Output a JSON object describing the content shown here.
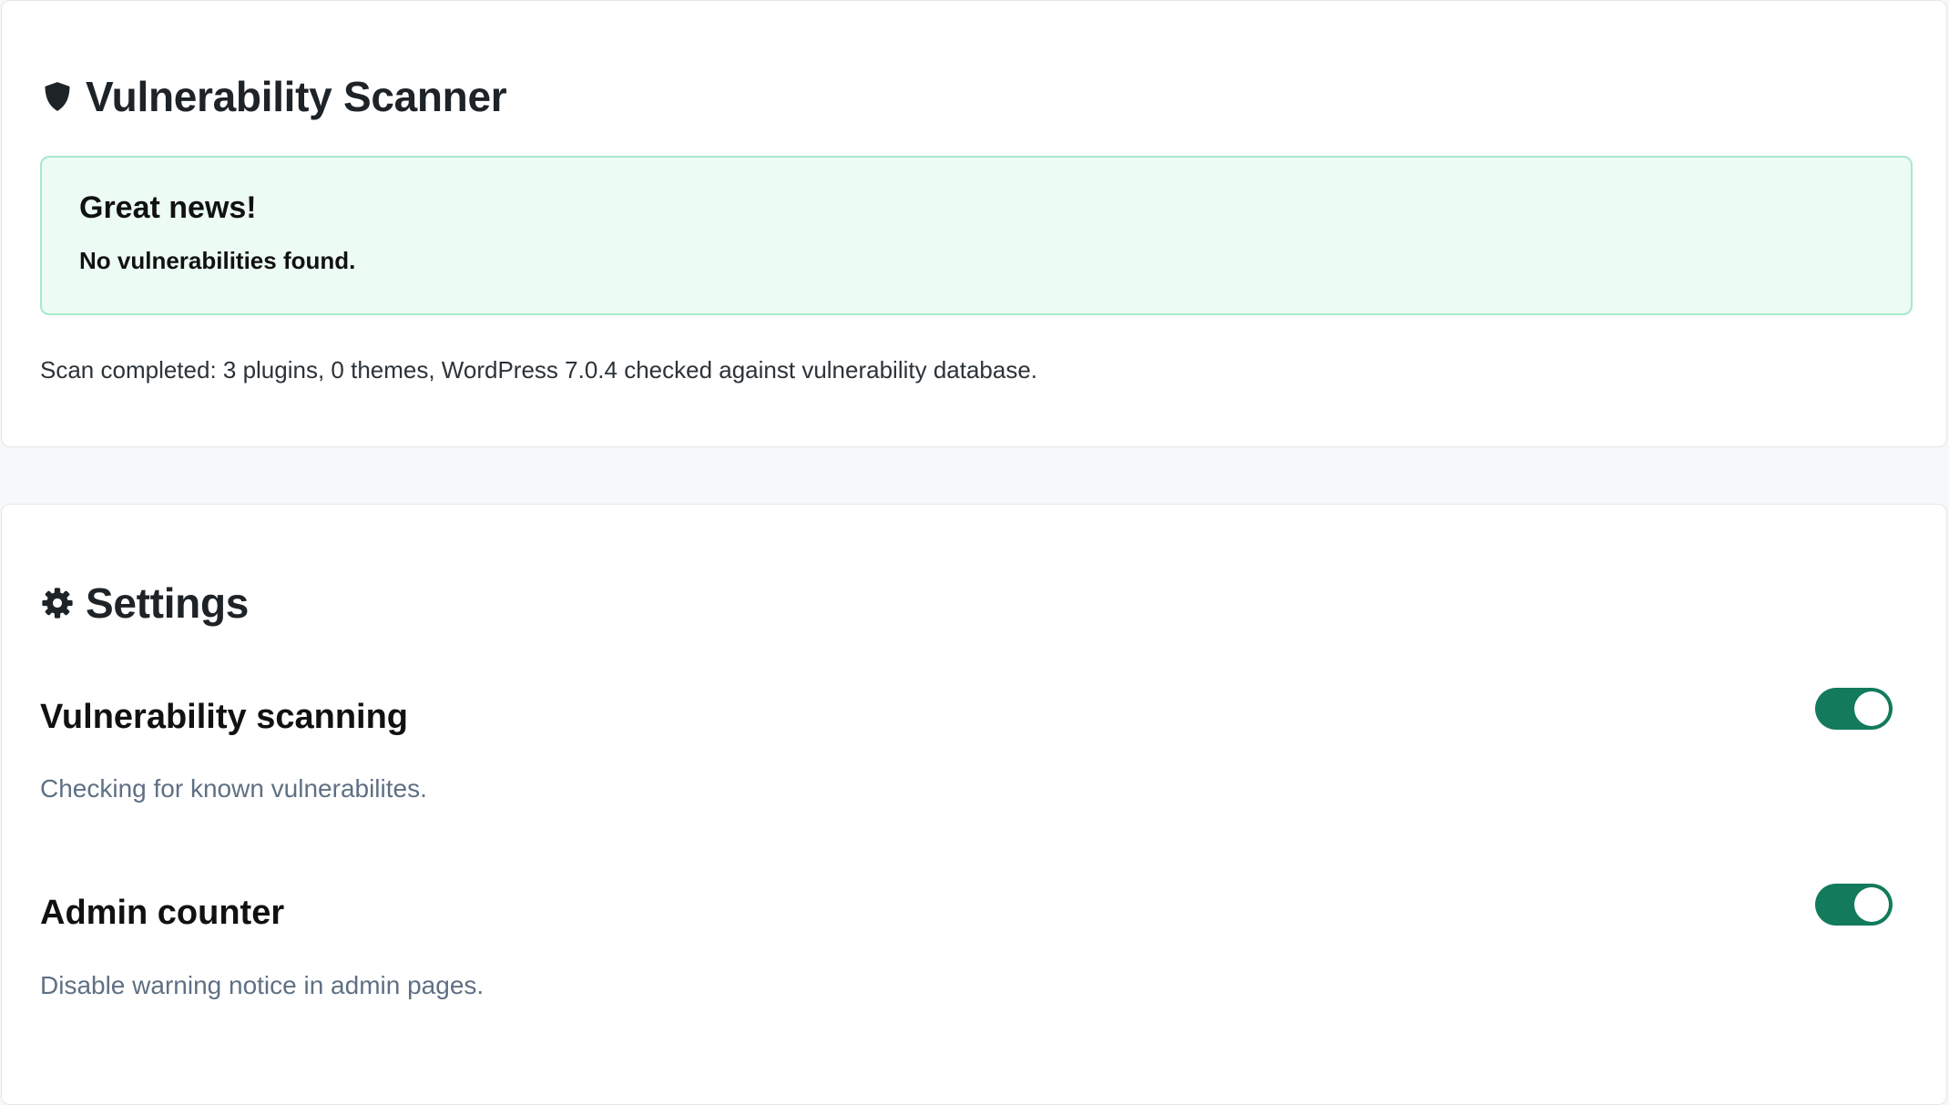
{
  "scanner": {
    "title": "Vulnerability Scanner",
    "notice": {
      "title": "Great news!",
      "text": "No vulnerabilities found."
    },
    "summary": "Scan completed: 3 plugins, 0 themes, WordPress 7.0.4 checked against vulnerability database."
  },
  "settings": {
    "title": "Settings",
    "items": [
      {
        "title": "Vulnerability scanning",
        "description": "Checking for known vulnerabilites.",
        "enabled": true
      },
      {
        "title": "Admin counter",
        "description": "Disable warning notice in admin pages.",
        "enabled": true
      }
    ]
  },
  "colors": {
    "toggle_on": "#137a5c",
    "notice_bg": "#ecfbf3",
    "notice_border": "#a7e9cb"
  },
  "icons": {
    "scanner": "shield-icon",
    "settings": "gear-icon"
  }
}
